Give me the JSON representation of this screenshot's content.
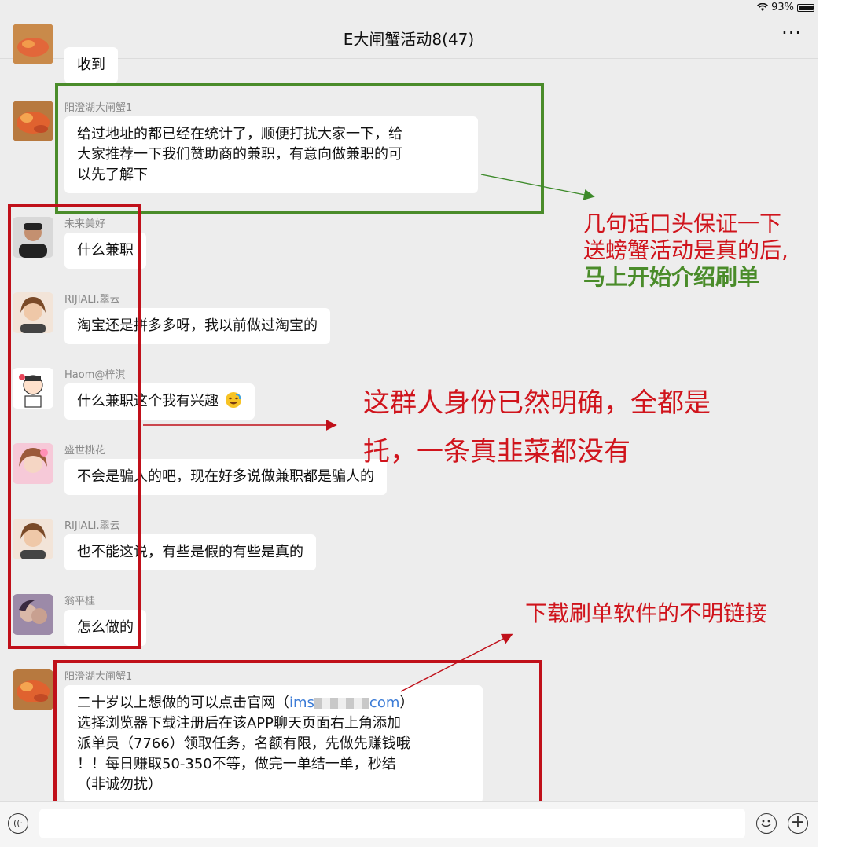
{
  "status_bar": {
    "battery": "93%",
    "battery_level": 0.93
  },
  "nav": {
    "back_glyph": "‹",
    "title": "E大闸蟹活动8(47)",
    "more_glyph": "···"
  },
  "messages": [
    {
      "sender": "",
      "text": "收到"
    },
    {
      "sender": "阳澄湖大闸蟹1",
      "lines": [
        "给过地址的都已经在统计了，顺便打扰大家一下，给",
        "大家推荐一下我们赞助商的兼职，有意向做兼职的可",
        "以先了解下"
      ]
    },
    {
      "sender": "未来美好",
      "text": "什么兼职"
    },
    {
      "sender": "RIJIALI.翠云",
      "text": "淘宝还是拼多多呀，我以前做过淘宝的"
    },
    {
      "sender": "Haom@梓淇",
      "text": "什么兼职这个我有兴趣"
    },
    {
      "sender": "盛世桃花",
      "text": "不会是骗人的吧，现在好多说做兼职都是骗人的"
    },
    {
      "sender": "RIJIALI.翠云",
      "text": "也不能这说，有些是假的有些是真的"
    },
    {
      "sender": "翁平桂",
      "text": "怎么做的"
    },
    {
      "sender": "阳澄湖大闸蟹1",
      "line1_before": "二十岁以上想做的可以点击官网（",
      "link_start": "ims",
      "link_end": "com",
      "line1_after": "）",
      "lines": [
        "选择浏览器下载注册后在该APP聊天页面右上角添加",
        "派单员（7766）领取任务，名额有限，先做先赚钱哦",
        "！！每日赚取50-350不等，做完一单结一单，秒结",
        "（非诚勿扰）"
      ]
    }
  ],
  "annotations": {
    "green_box_note": [
      "几句话口头保证一下",
      "送螃蟹活动是真的后,",
      "马上开始介绍刷单"
    ],
    "red_box_note": [
      "这群人身份已然明确，全都是",
      "托，一条真韭菜都没有"
    ],
    "link_note": "下载刷单软件的不明链接"
  },
  "colors": {
    "green": "#4a8c2a",
    "red": "#d0141c",
    "link": "#3b7bd6"
  },
  "input": {
    "placeholder": "",
    "value": ""
  },
  "icons": {
    "voice": "voice-icon",
    "emoji": "emoji-icon",
    "plus": "plus-icon",
    "wifi": "wifi-icon",
    "battery": "battery-icon"
  }
}
